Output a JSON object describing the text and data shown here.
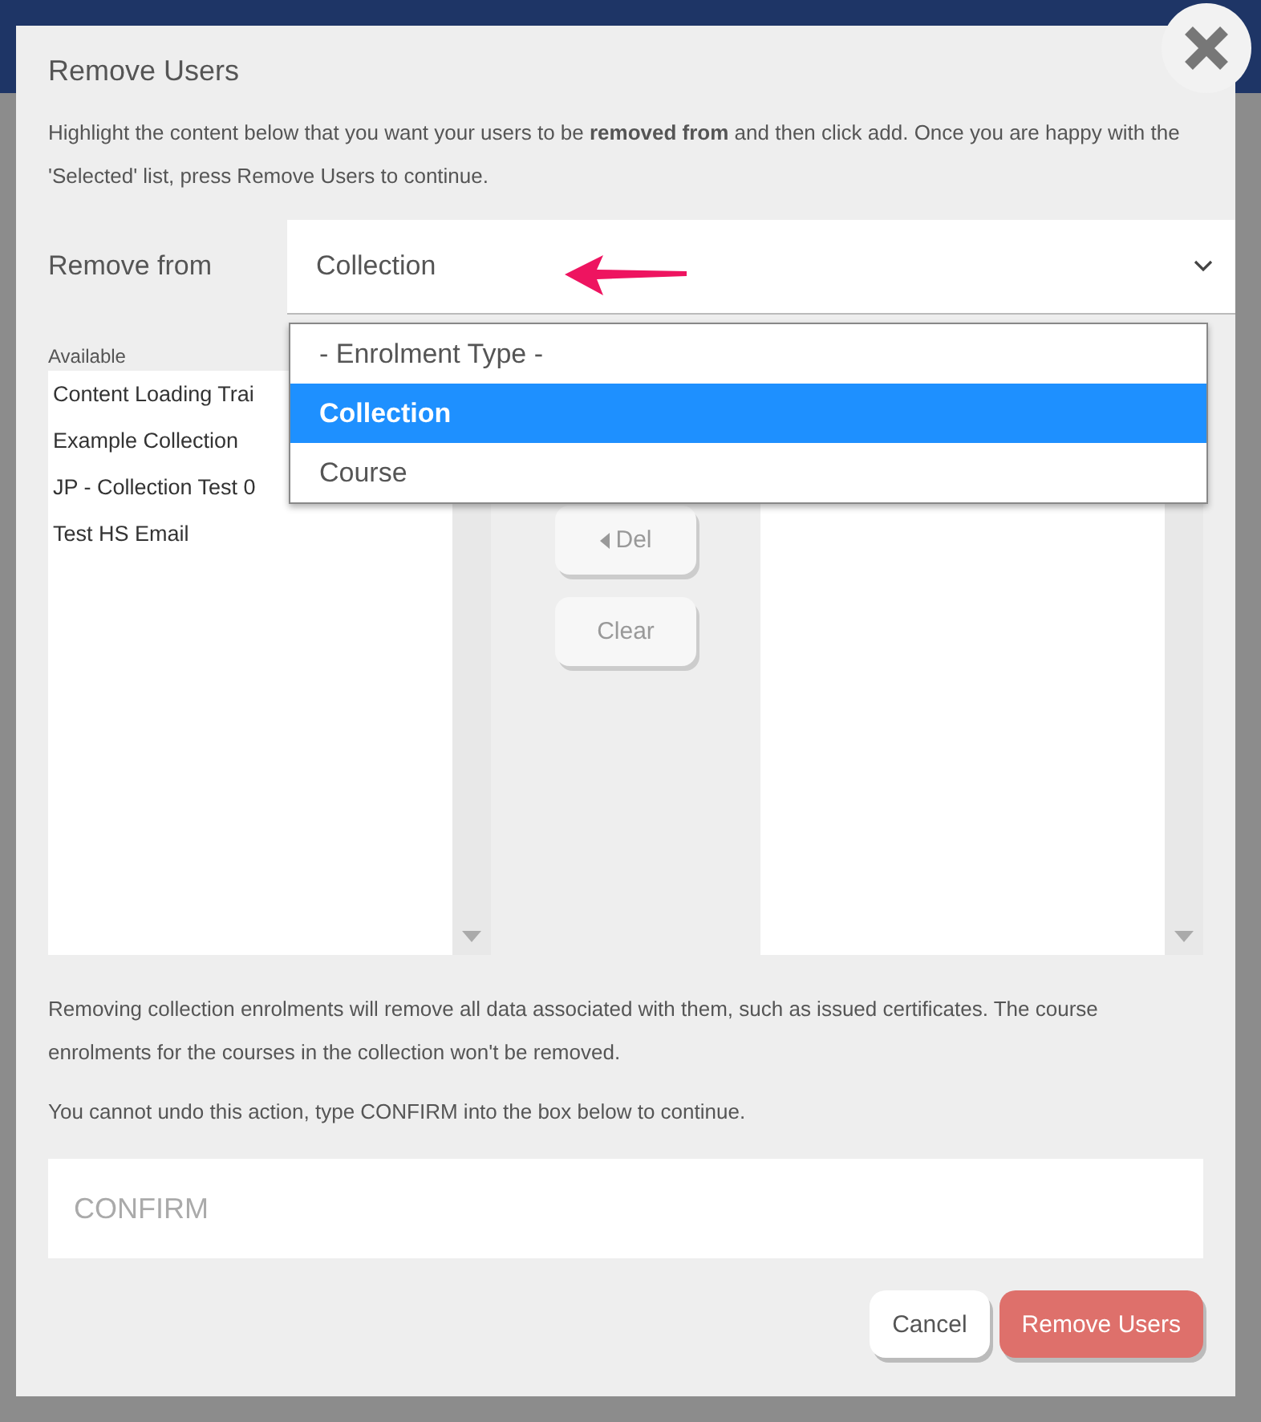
{
  "dialog": {
    "title": "Remove Users",
    "intro": "Highlight the content below that you want your users to be **removed from** and then click add. Once you are happy with the 'Selected' list, press Remove Users to continue.",
    "remove_from": {
      "label": "Remove from",
      "value": "Collection",
      "expanded": true,
      "options": [
        {
          "label": "- Enrolment Type -",
          "selected": false
        },
        {
          "label": "Collection",
          "selected": true
        },
        {
          "label": "Course",
          "selected": false
        }
      ]
    },
    "available": {
      "label": "Available",
      "items": [
        "Content Loading Trai",
        "Example Collection",
        "JP - Collection Test 0",
        "Test HS Email"
      ]
    },
    "middle_buttons": [
      {
        "label": "Del",
        "kind": "del"
      },
      {
        "label": "Clear",
        "kind": "clear"
      }
    ],
    "warning": "Removing collection enrolments will remove all data associated with them, such as issued certificates. The course enrolments for the courses in the collection won't be removed.",
    "confirm_hint": "You cannot undo this action, type CONFIRM into the box below to continue.",
    "confirm_field": {
      "placeholder": "CONFIRM"
    },
    "buttons": [
      {
        "label": "Cancel",
        "kind": "secondary"
      },
      {
        "label": "Remove Users",
        "kind": "danger"
      }
    ]
  }
}
